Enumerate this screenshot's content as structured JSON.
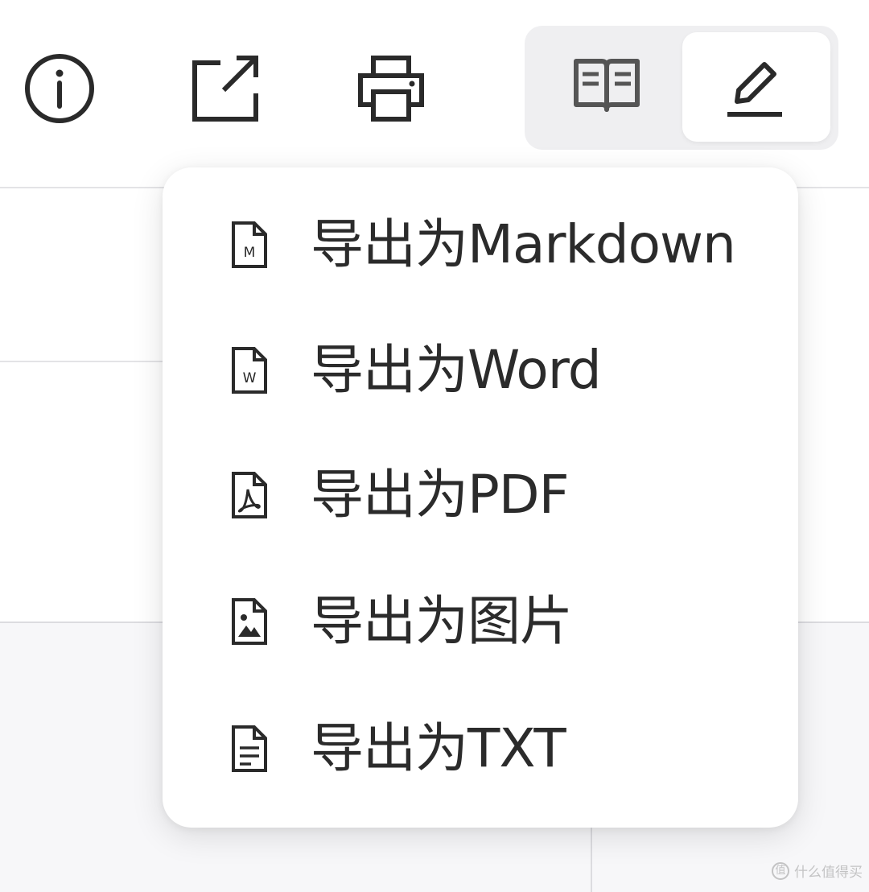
{
  "toolbar": {
    "info_icon": "info-circle-icon",
    "share_icon": "external-link-icon",
    "print_icon": "printer-icon",
    "mode_toggle": {
      "read_icon": "book-open-icon",
      "edit_icon": "pencil-icon",
      "active": "edit"
    }
  },
  "export_menu": {
    "items": [
      {
        "label": "导出为Markdown",
        "icon": "markdown-file-icon",
        "badge": "M"
      },
      {
        "label": "导出为Word",
        "icon": "word-file-icon",
        "badge": "W"
      },
      {
        "label": "导出为PDF",
        "icon": "pdf-file-icon"
      },
      {
        "label": "导出为图片",
        "icon": "image-file-icon"
      },
      {
        "label": "导出为TXT",
        "icon": "text-file-icon"
      }
    ]
  },
  "watermark": {
    "logo": "值",
    "text": "什么值得买"
  },
  "colors": {
    "icon_stroke": "#2a2a2a",
    "toggle_bg": "#efeff1",
    "menu_bg": "#ffffff",
    "page_bg": "#ffffff"
  }
}
